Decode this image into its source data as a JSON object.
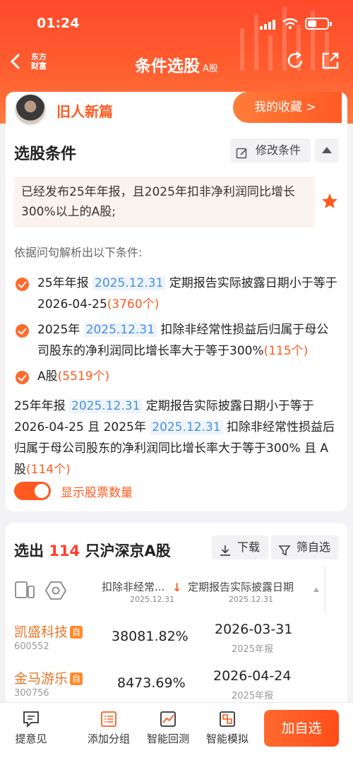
{
  "status_bar": {
    "time": "01:24"
  },
  "nav": {
    "logo": "东方财富",
    "title": "条件选股",
    "title_suffix": "A股"
  },
  "user": {
    "name": "旧人新篇",
    "favorites_button": "我的收藏 >"
  },
  "conditions_section": {
    "title": "选股条件",
    "edit_button": "修改条件",
    "query": "已经发布25年年报，且2025年扣非净利润同比增长300%以上的A股;",
    "parse_hint": "依据问句解析出以下条件:",
    "conditions": [
      {
        "pre": "25年年报 ",
        "date": "2025.12.31",
        "post": " 定期报告实际披露日期小于等于2026-04-25",
        "count": "(3760个)"
      },
      {
        "pre": "2025年 ",
        "date": "2025.12.31",
        "post": " 扣除非经常性损益后归属于母公司股东的净利润同比增长率大于等于300%",
        "count": "(115个)"
      },
      {
        "pre": "A股",
        "date": "",
        "post": "",
        "count": "(5519个)"
      }
    ],
    "combined": {
      "p1": "25年年报 ",
      "d1": "2025.12.31",
      "p2": " 定期报告实际披露日期小于等于2026-04-25 且 2025年 ",
      "d2": "2025.12.31",
      "p3": " 扣除非经常性损益后归属于母公司股东的净利润同比增长率大于等于300% 且 A股",
      "count": "(114个)"
    },
    "toggle_label": "显示股票数量",
    "toggle_on": true
  },
  "results": {
    "title_pre": "选出 ",
    "count": "114",
    "title_post": " 只沪深京A股",
    "download_button": "下载",
    "filter_button": "筛自选",
    "columns": [
      {
        "label": "扣除非经常...",
        "sub": "2025.12.31"
      },
      {
        "label": "定期报告实际披露日期",
        "sub": "2025.12.31"
      }
    ],
    "rows": [
      {
        "name": "凯盛科技",
        "badge": "自",
        "code": "600552",
        "value": "38081.82%",
        "date": "2026-03-31",
        "report": "2025年报"
      },
      {
        "name": "金马游乐",
        "badge": "自",
        "code": "300756",
        "value": "8473.69%",
        "date": "2026-04-24",
        "report": "2025年报"
      }
    ]
  },
  "bottom_bar": {
    "tabs": [
      "提意见",
      "添加分组",
      "智能回测",
      "智能模拟"
    ],
    "add_button": "加自选"
  },
  "colors": {
    "accent": "#ff5a1f",
    "header": "#fe4a2c",
    "date_tag": "#4a8fe0"
  }
}
